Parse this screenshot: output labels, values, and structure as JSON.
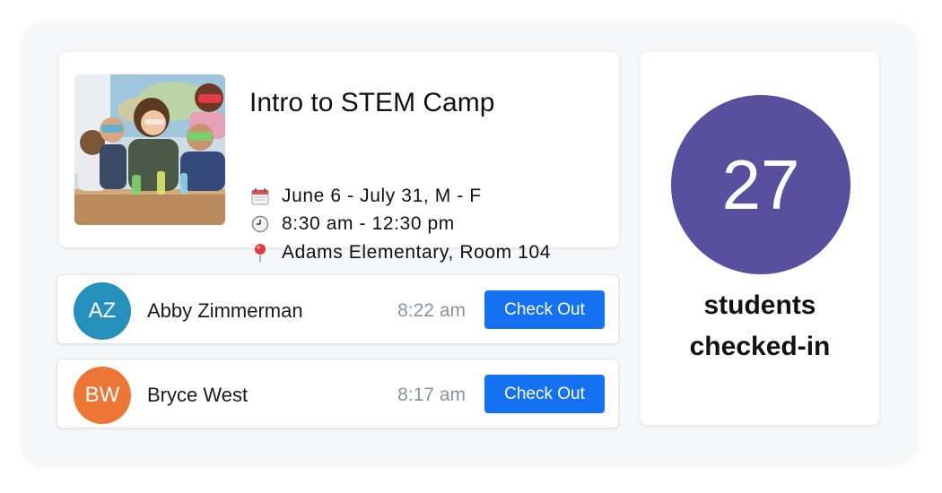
{
  "colors": {
    "accent_button": "#1472f2",
    "count_circle": "#5a4f9e",
    "avatar_az": "#2490bb",
    "avatar_bw": "#ee7634",
    "time_text": "#8e9398"
  },
  "camp": {
    "title": "Intro to STEM Camp",
    "photo_alt": "children-science-class-photo",
    "details": [
      {
        "icon": "calendar-icon",
        "text": "June 6 - July 31, M - F"
      },
      {
        "icon": "clock-icon",
        "text": "8:30 am - 12:30 pm"
      },
      {
        "icon": "location-pin-icon",
        "text": "Adams Elementary, Room 104"
      }
    ]
  },
  "students": [
    {
      "initials": "AZ",
      "name": "Abby Zimmerman",
      "time": "8:22 am",
      "button_label": "Check Out"
    },
    {
      "initials": "BW",
      "name": "Bryce West",
      "time": "8:17 am",
      "button_label": "Check Out"
    }
  ],
  "checked_in": {
    "count": "27",
    "label_line1": "students",
    "label_line2": "checked-in"
  }
}
